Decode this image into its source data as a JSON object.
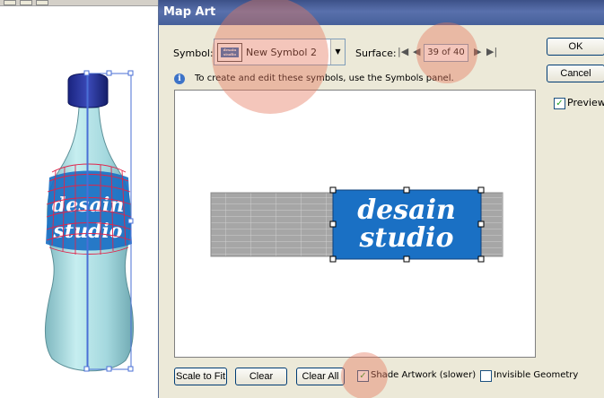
{
  "dialog": {
    "title": "Map Art",
    "symbol_label": "Symbol:",
    "symbol_value": "New Symbol 2",
    "surface_label": "Surface:",
    "surface_value": "39 of 40",
    "info_text": "To create and edit these symbols, use the Symbols panel.",
    "ok_label": "OK",
    "cancel_label": "Cancel",
    "preview_label": "Preview",
    "preview_checked": true,
    "scale_to_fit_label": "Scale to Fit",
    "clear_label": "Clear",
    "clear_all_label": "Clear All",
    "shade_artwork_label": "Shade Artwork (slower)",
    "shade_artwork_checked": true,
    "invisible_geometry_label": "Invisible Geometry",
    "invisible_geometry_checked": false
  },
  "artwork": {
    "line1": "desain",
    "line2": "studio",
    "label_color": "#1a70c4"
  },
  "colors": {
    "title_bar": "#3c5188",
    "dialog_bg": "#ece9d8",
    "highlight": "#e4785c",
    "bottle_glass": "#aadde2",
    "bottle_cap": "#2c3a9c",
    "wireframe": "#e0254a"
  }
}
